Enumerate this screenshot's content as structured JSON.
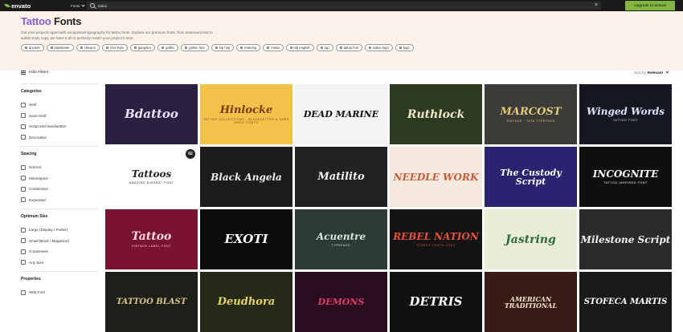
{
  "header": {
    "logo": "envato",
    "category": "Fonts",
    "search_value": "tattoo",
    "clear_icon": "close-icon",
    "upgrade_label": "Upgrade to annual"
  },
  "hero": {
    "title_accent": "Tattoo",
    "title_rest": " Fonts",
    "description": "Get your projects apart with exceptional typography for tattoo fonts. Explore our premium fonts, from statement text to subtle body copy, we have it all to perfectly match your project's tone.",
    "tags": [
      "ancient",
      "blackletter",
      "chicano",
      "font style",
      "gangster",
      "gothic",
      "gothic font",
      "hip hop",
      "lettering",
      "metal",
      "old english",
      "rap",
      "tattoo font",
      "tattoo logo",
      "logo"
    ]
  },
  "controls": {
    "hide_filters": "Hide Filters",
    "sort_prefix": "Sort by",
    "sort_value": "Relevant"
  },
  "filters": [
    {
      "title": "Categories",
      "options": [
        "Serif",
        "Sans-Serif",
        "Script and Handwritten",
        "Decorative"
      ]
    },
    {
      "title": "Spacing",
      "options": [
        "Normal",
        "Monospace",
        "Condensed",
        "Expanded"
      ]
    },
    {
      "title": "Optimum Size",
      "options": [
        "Large (Display / Poster)",
        "Small (Book / Magazine)",
        "Condensed",
        "Any Size"
      ]
    },
    {
      "title": "Properties",
      "options": [
        "Web Font"
      ]
    }
  ],
  "fonts": [
    {
      "title": "Bdattoo",
      "sub": "",
      "bg": "#2a2040",
      "fg": "#e8e2ff",
      "size": 15
    },
    {
      "title": "Hinlocke",
      "sub": "Tattoo Collections · Blackletter & Sans Serif Fonts",
      "bg": "#f2c24b",
      "fg": "#7a3a12",
      "size": 13
    },
    {
      "title": "DEAD MARINE",
      "sub": "",
      "bg": "#f3f3f3",
      "fg": "#111111",
      "size": 11
    },
    {
      "title": "Ruthlock",
      "sub": "",
      "bg": "#2e3a1f",
      "fg": "#f0e6c8",
      "size": 14
    },
    {
      "title": "MARCOST",
      "sub": "Vintage · Tata Typeface",
      "bg": "#3b3b38",
      "fg": "#e2c97a",
      "size": 13
    },
    {
      "title": "Winged Words",
      "sub": "Tattoo Font",
      "bg": "#151820",
      "fg": "#dbe3ff",
      "size": 12
    },
    {
      "title": "Tattoos",
      "sub": "Amazing Dingbat Font",
      "bg": "#ffffff",
      "fg": "#222222",
      "size": 12,
      "badge": "62"
    },
    {
      "title": "Black Angela",
      "sub": "",
      "bg": "#1c1c1c",
      "fg": "#eeeeee",
      "size": 12
    },
    {
      "title": "Matilito",
      "sub": "",
      "bg": "#222222",
      "fg": "#f5f5f5",
      "size": 13
    },
    {
      "title": "NEEDLE WORK",
      "sub": "",
      "bg": "#f4e9dc",
      "fg": "#c95a3a",
      "size": 12
    },
    {
      "title": "The Custody Script",
      "sub": "",
      "bg": "#2a2370",
      "fg": "#ffffff",
      "size": 11
    },
    {
      "title": "INCOGNITE",
      "sub": "Tattoo Inspired Font",
      "bg": "#0f0f0f",
      "fg": "#ffffff",
      "size": 12
    },
    {
      "title": "Tattoo",
      "sub": "Vintage label font",
      "bg": "#7a1330",
      "fg": "#ffd8e6",
      "size": 14
    },
    {
      "title": "EXOTI",
      "sub": "",
      "bg": "#0b0b0b",
      "fg": "#ffffff",
      "size": 15
    },
    {
      "title": "Acuentre",
      "sub": "Typeface",
      "bg": "#2c3b34",
      "fg": "#d7e6da",
      "size": 12
    },
    {
      "title": "REBEL NATION",
      "sub": "Street Youth Font",
      "bg": "#141414",
      "fg": "#e6533a",
      "size": 12
    },
    {
      "title": "Jastring",
      "sub": "",
      "bg": "#e8eed6",
      "fg": "#2f6b3a",
      "size": 14
    },
    {
      "title": "Milestone Script",
      "sub": "",
      "bg": "#2b2b2b",
      "fg": "#efefef",
      "size": 12
    },
    {
      "title": "TATTOO BLAST",
      "sub": "",
      "bg": "#1f1f1a",
      "fg": "#d8c38a",
      "size": 10
    },
    {
      "title": "Deudhora",
      "sub": "",
      "bg": "#262a18",
      "fg": "#e6d36a",
      "size": 13
    },
    {
      "title": "DEMONS",
      "sub": "",
      "bg": "#2a0d1f",
      "fg": "#e23a6a",
      "size": 11
    },
    {
      "title": "DETRIS",
      "sub": "",
      "bg": "#111111",
      "fg": "#ffffff",
      "size": 15
    },
    {
      "title": "AMERICAN TRADITIONAL",
      "sub": "",
      "bg": "#3a1c17",
      "fg": "#f1e3cf",
      "size": 8
    },
    {
      "title": "STOFECA MARTIS",
      "sub": "",
      "bg": "#1a1a1a",
      "fg": "#ffffff",
      "size": 10
    }
  ],
  "colors": {
    "accent": "#8a5bd6",
    "upgrade": "#82b541",
    "hero_bg": "#f9f1ea"
  }
}
